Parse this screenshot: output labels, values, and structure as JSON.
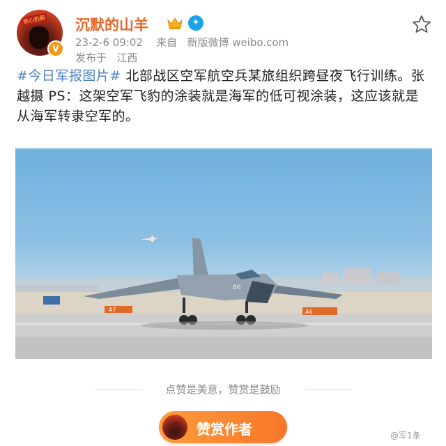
{
  "header": {
    "username": "沉默的山羊",
    "avatar_tag": "熊心豹胆",
    "timestamp": "23-2-6 09:02",
    "source_prefix": "来自",
    "source": "新版微博 weibo.com",
    "location_prefix": "发布于",
    "location": "江西"
  },
  "post": {
    "hashtag": "#今日军报图片#",
    "text": " 北部战区空军航空兵某旅组织跨昼夜飞行训练。张 越摄 PS：这架空军飞豹的涂装就是海军的低可视涂装，这应该就是从海军转隶空军的。"
  },
  "photo": {
    "nose_number": "86",
    "sign_left": "A7",
    "sign_right": "A6"
  },
  "footer": {
    "reward_slogan": "点赞是美意，赞赏是鼓励",
    "reward_button": "赞赏作者",
    "watermark": "@军1条"
  },
  "icons": {
    "crown": "crown-icon",
    "verify": "verified-icon",
    "star": "star-icon"
  },
  "colors": {
    "username": "#e7682a",
    "hashtag": "#4a7fc1",
    "reward_button": "#f7762a"
  }
}
